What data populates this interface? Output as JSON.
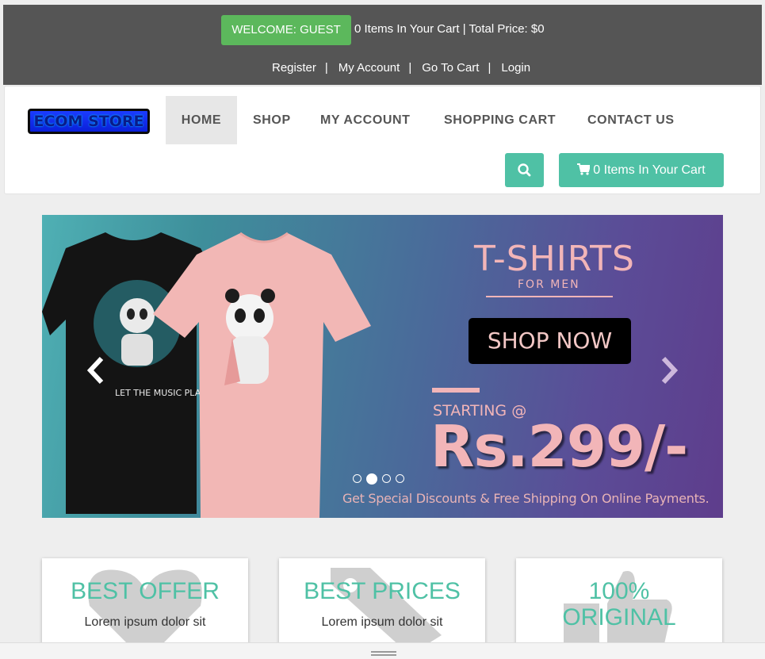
{
  "topbar": {
    "welcome_label": "WELCOME: GUEST",
    "cart_info": "0 Items In Your Cart | Total Price: $0",
    "links": [
      "Register",
      "My Account",
      "Go To Cart",
      "Login"
    ]
  },
  "nav": {
    "logo_text": "ECOM STORE",
    "items": [
      "HOME",
      "SHOP",
      "MY ACCOUNT",
      "SHOPPING CART",
      "CONTACT US"
    ],
    "active_item": "HOME",
    "cart_button": "0 Items In Your Cart"
  },
  "carousel": {
    "title": "T-SHIRTS",
    "subtitle": "FOR MEN",
    "cta": "SHOP NOW",
    "starting": "STARTING @",
    "price": "Rs.299/-",
    "footer_text": "Get Special Discounts & Free Shipping On Online Payments.",
    "shirt_text": "LET THE MUSIC PLAY",
    "active_slide": 2,
    "slide_count": 4
  },
  "boxes": [
    {
      "title": "BEST OFFER",
      "text": "Lorem ipsum dolor sit",
      "icon": "heart-icon"
    },
    {
      "title": "BEST PRICES",
      "text": "Lorem ipsum dolor sit",
      "icon": "tag-icon"
    },
    {
      "title": "100% ORIGINAL",
      "text": "",
      "icon": "thumbs-up-icon"
    }
  ],
  "colors": {
    "topbar": "#555555",
    "welcome": "#5cb85c",
    "accent": "#4fc1a5",
    "banner_pink": "#f2b5b8"
  }
}
